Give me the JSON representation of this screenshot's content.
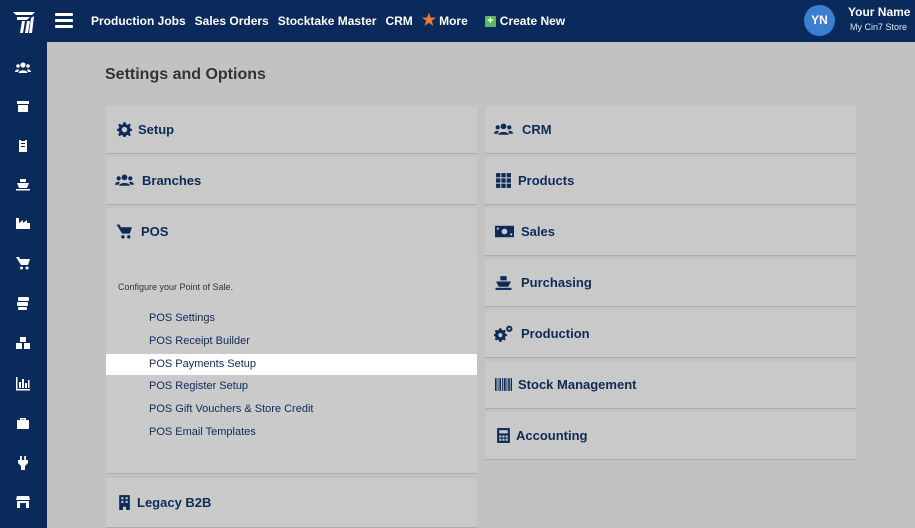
{
  "topbar": {
    "nav": [
      "Production Jobs",
      "Sales Orders",
      "Stocktake Master",
      "CRM"
    ],
    "more_label": "More",
    "create_label": "Create New",
    "avatar_initials": "YN",
    "user_name": "Your Name",
    "store_name": "My Cin7 Store",
    "colors": {
      "bar": "#0a2a5c",
      "star": "#f07c30",
      "create": "#5cb85c",
      "avatar": "#3b7fd0"
    }
  },
  "sidebar": {
    "icons": [
      "users-icon",
      "box-icon",
      "clipboard-icon",
      "ship-icon",
      "factory-icon",
      "cart-icon",
      "coins-icon",
      "warehouse-icon",
      "chart-icon",
      "briefcase-icon",
      "plug-icon",
      "store-icon"
    ]
  },
  "page": {
    "title": "Settings and Options"
  },
  "left_cards": {
    "setup": "Setup",
    "branches": "Branches",
    "pos": "POS",
    "legacy": "Legacy B2B"
  },
  "pos": {
    "description": "Configure your Point of Sale.",
    "links": [
      "POS Settings",
      "POS Receipt Builder",
      "POS Payments Setup",
      "POS Register Setup",
      "POS Gift Vouchers & Store Credit",
      "POS Email Templates"
    ],
    "active_link": "POS Payments Setup"
  },
  "right_cards": {
    "crm": "CRM",
    "products": "Products",
    "sales": "Sales",
    "purchasing": "Purchasing",
    "production": "Production",
    "stock": "Stock Management",
    "accounting": "Accounting"
  }
}
